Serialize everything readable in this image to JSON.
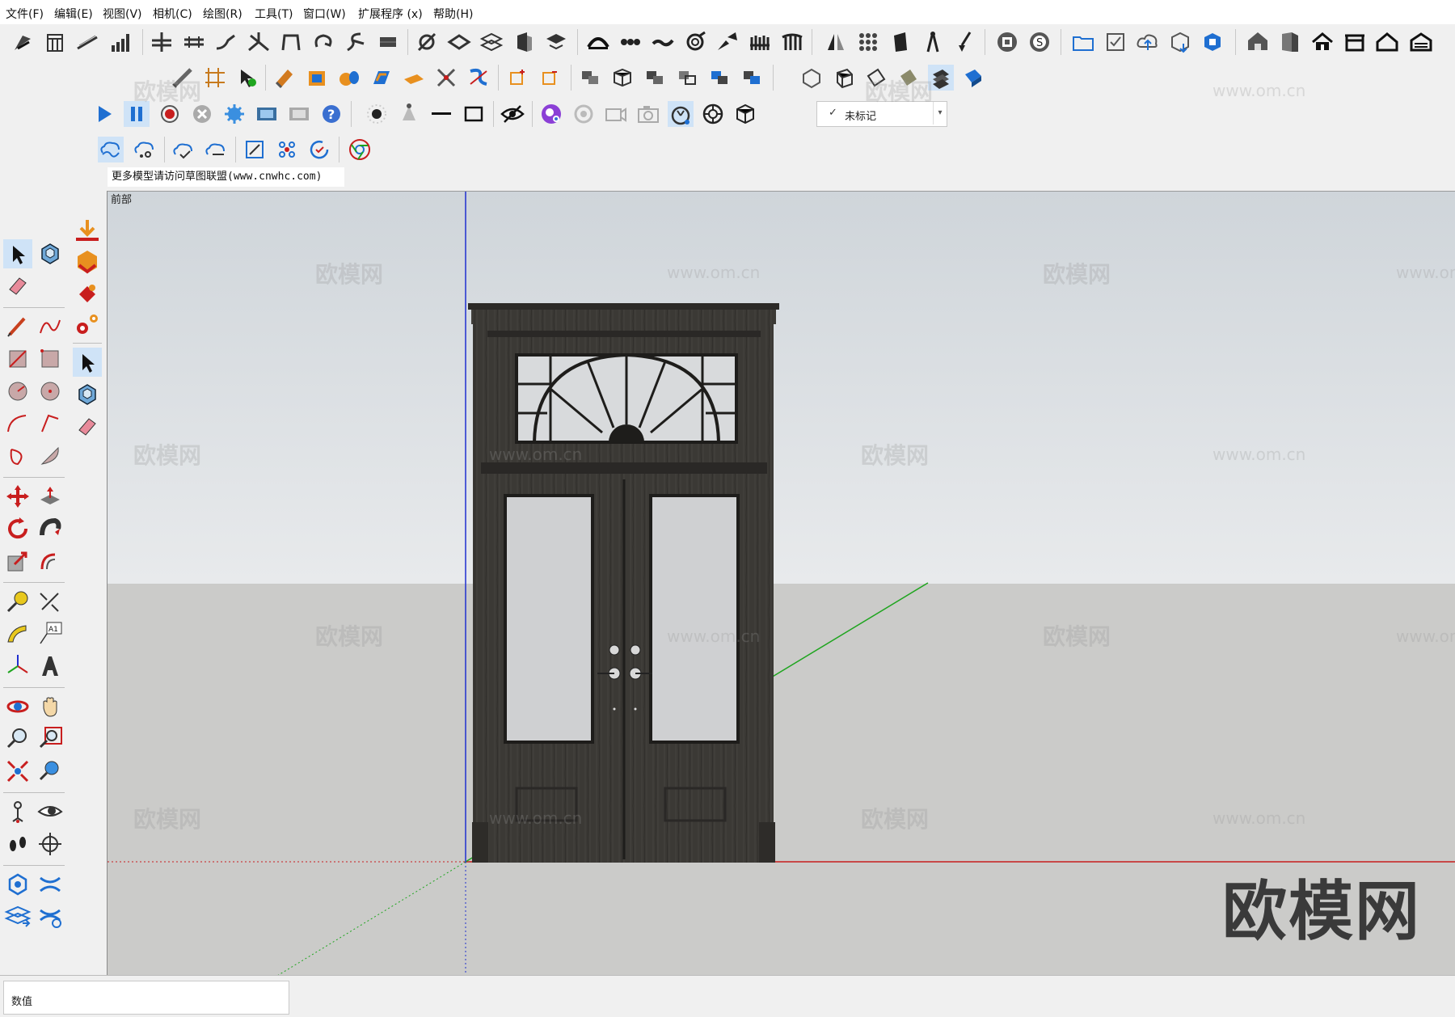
{
  "menu": [
    {
      "label": "文件(F)"
    },
    {
      "label": "编辑(E)"
    },
    {
      "label": "视图(V)"
    },
    {
      "label": "相机(C)"
    },
    {
      "label": "绘图(R)"
    },
    {
      "label": "工具(T)"
    },
    {
      "label": "窗口(W)"
    },
    {
      "label": "扩展程序 (x)"
    },
    {
      "label": "帮助(H)"
    }
  ],
  "tag_dropdown": {
    "check": "✓",
    "value": "未标记"
  },
  "document_tab": {
    "label": "更多模型请访问草图联盟(www.cnwhc.com)"
  },
  "scene": {
    "label": "前部"
  },
  "status": {
    "measurements_label": "数值"
  },
  "watermarks": {
    "site_name": "欧模网",
    "site_url": "www.om.cn",
    "corner_text": "欧模网"
  },
  "colors": {
    "accent": "#1f6fd1",
    "active_bg": "#cfe3f7",
    "axis_red": "#c81e1e",
    "axis_green": "#1fa51f",
    "axis_blue": "#1f2fd0",
    "door_wood": "#3a3835",
    "sky_top": "#cfd5da",
    "ground": "#cbcbc9"
  },
  "icons": {
    "row1": [
      "follow-me-icon",
      "table-icon",
      "line-stitch-icon",
      "bar-chart-icon",
      "layers-stack-icon",
      "double-line-icon",
      "curve-tool-icon",
      "branch-icon",
      "arch-icon",
      "loop-icon",
      "spiral-icon",
      "wall-icon",
      "path-icon",
      "box-layers-icon",
      "grid-box-icon",
      "door-icon",
      "tray-icon",
      "arc-icon",
      "chain-icon",
      "wave-icon",
      "swirl-icon",
      "pen-ruler-icon",
      "fence-icon",
      "bridge-icon",
      "mirror-icon",
      "dot-grid-icon",
      "panel-icon",
      "compass-icon",
      "brush-icon",
      "film-icon",
      "s-ring-icon",
      "folder-icon",
      "checkbox-icon",
      "cloud-up-icon",
      "cube-down-icon",
      "rotate-cube-icon",
      "house-3d-icon",
      "book-icon",
      "home-icon",
      "store-icon",
      "home-outline-icon",
      "garage-icon"
    ],
    "row2": [
      "ruler-pen-icon",
      "frame-icon",
      "cursor-arrow-icon",
      "shovel-icon",
      "box-orange-icon",
      "cylinder-icon",
      "shape-icon",
      "prism-icon",
      "cross-tool-icon",
      "snake-icon",
      "square-plus-icon",
      "square-minus-icon",
      "boxes-icon",
      "cube-icon",
      "cubes-icon",
      "cube-gray-icon",
      "cube-blue-icon",
      "cube-group-icon",
      "iso-cube-icon",
      "cube-outline-icon",
      "plane-icon",
      "slab-icon",
      "stack-icon",
      "blue-cube-icon"
    ],
    "row3": [
      "play-icon",
      "pause-icon",
      "record-icon",
      "stop-icon",
      "gear-icon",
      "film-strip-icon",
      "film-gray-icon",
      "help-icon",
      "dot-light-icon",
      "cone-light-icon",
      "line-light-icon",
      "rect-light-icon",
      "eye-hide-icon",
      "render-icon",
      "circle-gray-icon",
      "camera-icon",
      "snapshot-icon",
      "timer-icon",
      "flower-icon",
      "box-export-icon"
    ],
    "row4": [
      "cloud-wave-icon",
      "cloud-tree-icon",
      "cloud-check-icon",
      "cloud-minus-icon",
      "frame-select-icon",
      "cluster-icon",
      "refresh-check-icon",
      "chrome-icon"
    ]
  }
}
